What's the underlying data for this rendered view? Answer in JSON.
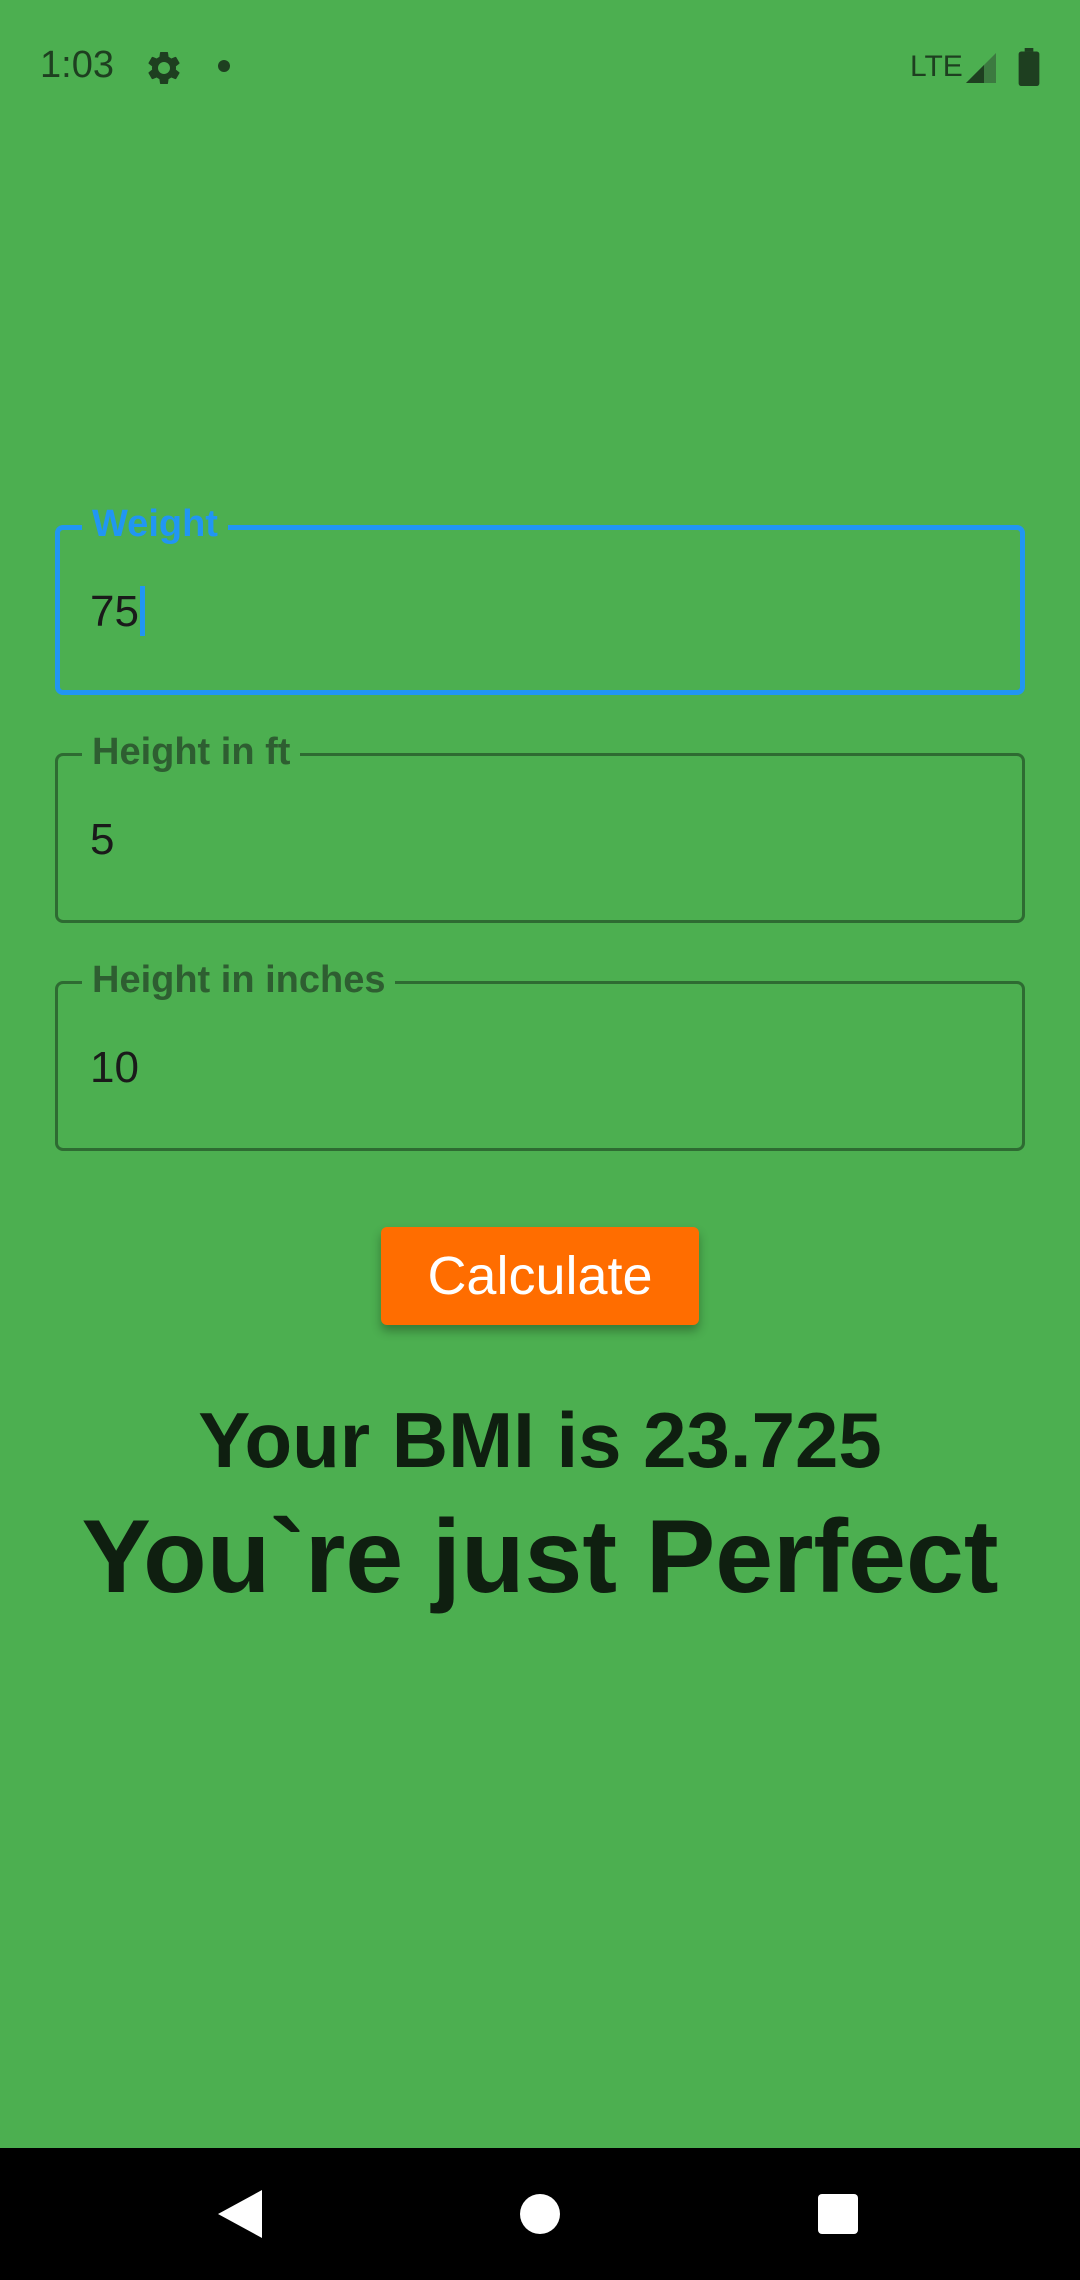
{
  "status_bar": {
    "time": "1:03",
    "network": "LTE",
    "icons": [
      "gear-icon",
      "notification-dot-icon",
      "signal-icon",
      "battery-icon"
    ]
  },
  "form": {
    "weight": {
      "label": "Weight",
      "value": "75",
      "focused": true
    },
    "height_ft": {
      "label": "Height in ft",
      "value": "5"
    },
    "height_in": {
      "label": "Height in inches",
      "value": "10"
    }
  },
  "button": {
    "label": "Calculate"
  },
  "result": {
    "bmi_text": "Your BMI is 23.725",
    "message": "You`re just Perfect"
  },
  "nav_bar": {
    "icons": [
      "back-icon",
      "home-icon",
      "recents-icon"
    ]
  },
  "colors": {
    "background": "#4CAF50",
    "focus_accent": "#2196F3",
    "button": "#FF6D00",
    "text": "#0F1F10"
  }
}
